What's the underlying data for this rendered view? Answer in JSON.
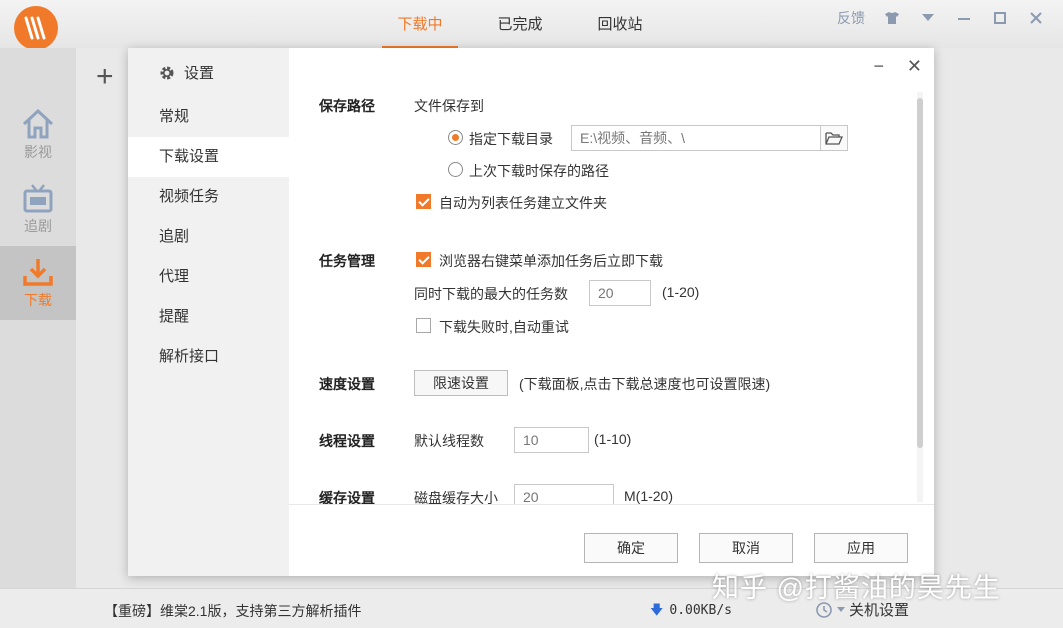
{
  "app": {
    "tabs": [
      "下载中",
      "已完成",
      "回收站"
    ],
    "feedback": "反馈",
    "nav": [
      "影视",
      "追剧",
      "下载"
    ],
    "status_news": "【重磅】维棠2.1版，支持第三方解析插件",
    "speed_arrow": "🡇",
    "speed": "0.00KB/s",
    "shutdown": "关机设置",
    "watermark": "知乎 @打酱油的昊先生",
    "accent": "#f07a2a"
  },
  "dialog": {
    "title": "设置",
    "minimize": "−",
    "close": "✕",
    "sidebar": [
      "常规",
      "下载设置",
      "视频任务",
      "追剧",
      "代理",
      "提醒",
      "解析接口"
    ],
    "save_path": {
      "title": "保存路径",
      "save_to": "文件保存到",
      "option_custom": "指定下载目录",
      "path_value": "E:\\视频、音频、\\",
      "option_last": "上次下载时保存的路径",
      "auto_folder": "自动为列表任务建立文件夹"
    },
    "task_mgmt": {
      "title": "任务管理",
      "browser_menu": "浏览器右键菜单添加任务后立即下载",
      "max_tasks_label": "同时下载的最大的任务数",
      "max_tasks_value": "20",
      "max_tasks_range": "(1-20)",
      "auto_retry": "下载失败时,自动重试"
    },
    "speed": {
      "title": "速度设置",
      "button": "限速设置",
      "hint": "(下载面板,点击下载总速度也可设置限速)"
    },
    "threads": {
      "title": "线程设置",
      "label": "默认线程数",
      "value": "10",
      "range": "(1-10)"
    },
    "cache": {
      "title": "缓存设置",
      "label": "磁盘缓存大小",
      "value": "20",
      "range": "M(1-20)"
    },
    "buttons": {
      "ok": "确定",
      "cancel": "取消",
      "apply": "应用"
    }
  }
}
